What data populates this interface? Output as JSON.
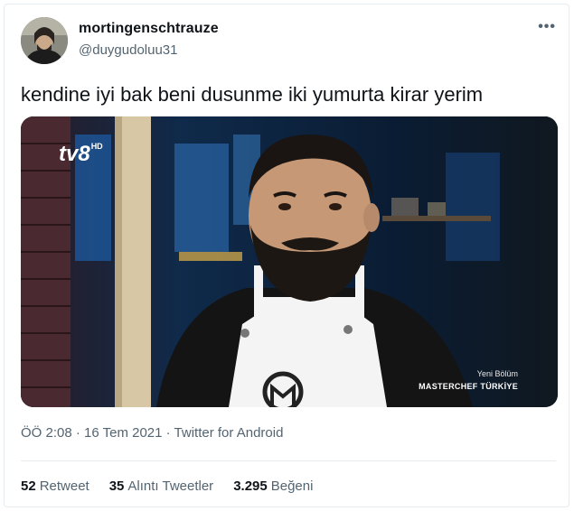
{
  "author": {
    "display_name": "mortingenschtrauze",
    "handle": "@duygudoluu31"
  },
  "tweet": {
    "text": "kendine iyi bak beni dusunme iki yumurta kirar yerim"
  },
  "media": {
    "channel_logo": "tv8",
    "channel_logo_hd": "HD",
    "caption_line1": "Yeni Bölüm",
    "caption_line2": "MASTERCHEF TÜRKİYE"
  },
  "meta": {
    "timestamp": "ÖÖ 2:08 · 16 Tem 2021 · Twitter for Android"
  },
  "stats": {
    "retweets_count": "52",
    "retweets_label": "Retweet",
    "quotes_count": "35",
    "quotes_label": "Alıntı Tweetler",
    "likes_count": "3.295",
    "likes_label": "Beğeni"
  },
  "icons": {
    "more": "more-dots-icon"
  }
}
